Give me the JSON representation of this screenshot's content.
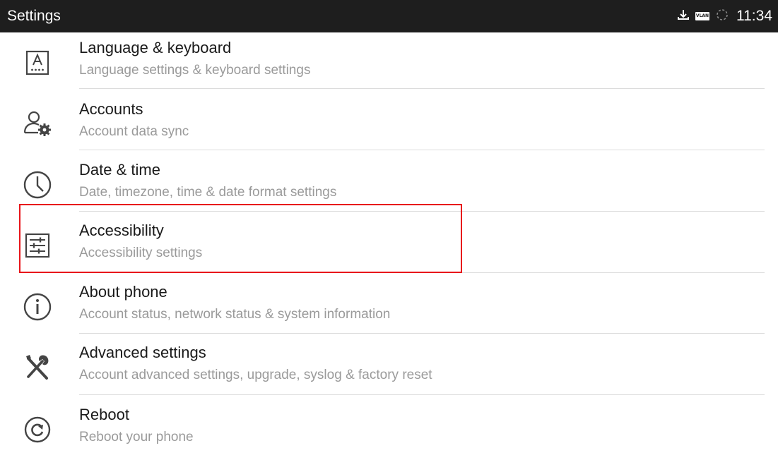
{
  "statusbar": {
    "title": "Settings",
    "vlan_label": "VLAN",
    "time": "11:34",
    "icons": [
      "download-icon",
      "vlan-icon",
      "sync-icon"
    ]
  },
  "settings": {
    "items": [
      {
        "title": "Language & keyboard",
        "subtitle": "Language settings & keyboard settings",
        "icon": "language-keyboard-icon"
      },
      {
        "title": "Accounts",
        "subtitle": "Account data sync",
        "icon": "accounts-icon"
      },
      {
        "title": "Date & time",
        "subtitle": "Date, timezone, time & date format settings",
        "icon": "clock-icon"
      },
      {
        "title": "Accessibility",
        "subtitle": "Accessibility settings",
        "icon": "accessibility-icon"
      },
      {
        "title": "About phone",
        "subtitle": "Account status, network status & system information",
        "icon": "info-icon"
      },
      {
        "title": "Advanced settings",
        "subtitle": "Account advanced settings, upgrade, syslog & factory reset",
        "icon": "tools-icon"
      },
      {
        "title": "Reboot",
        "subtitle": "Reboot your phone",
        "icon": "reboot-icon"
      }
    ]
  },
  "colors": {
    "statusbar_bg": "#1e1e1e",
    "title_text": "#1a1a1a",
    "subtitle_text": "#9a9a9a",
    "divider": "#dcdcdc",
    "highlight_border": "#e8151b"
  }
}
